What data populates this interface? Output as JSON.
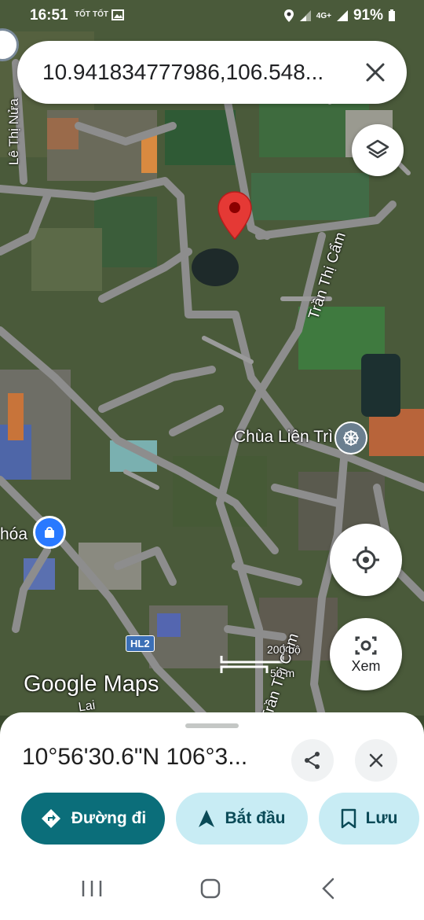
{
  "status_bar": {
    "time": "16:51",
    "mini_icons": [
      "TỐT",
      "TỐT"
    ],
    "network": "4G+",
    "battery": "91%"
  },
  "search": {
    "query": "10.941834777986,106.548..."
  },
  "map": {
    "roads": [
      "Lê Thị Nửa",
      "Trần Thị Cẩm",
      "Trần Thị Cẩm",
      "Lai"
    ],
    "poi_temple": "Chùa Liên Trì",
    "poi_shop": "hóa",
    "highway_badge": "HL2",
    "scale_ft": "200 bộ",
    "scale_m": "50 m",
    "watermark": "Google Maps",
    "view_label": "Xem"
  },
  "sheet": {
    "coordinates": "10°56'30.6\"N 106°3...",
    "buttons": {
      "directions": "Đường đi",
      "start": "Bắt đầu",
      "save": "Lưu"
    }
  },
  "colors": {
    "pin": "#e53935",
    "primary": "#0b6e7a",
    "secondary": "#c8ecf4"
  }
}
